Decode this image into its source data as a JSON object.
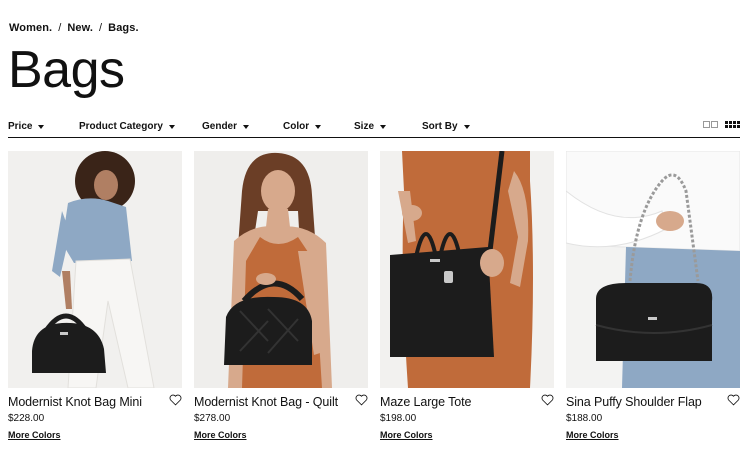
{
  "breadcrumb": [
    "Women.",
    "New.",
    "Bags."
  ],
  "breadcrumb_separator": "/",
  "page_title": "Bags",
  "filters": [
    "Price",
    "Product Category",
    "Gender",
    "Color",
    "Size",
    "Sort By"
  ],
  "view_options": [
    "two-column-grid-icon",
    "four-column-grid-icon"
  ],
  "products": [
    {
      "name": "Modernist Knot Bag Mini",
      "price": "$228.00",
      "colors_link": "More Colors",
      "background": "#f1f0ee"
    },
    {
      "name": "Modernist Knot Bag - Quilt",
      "price": "$278.00",
      "colors_link": "More Colors",
      "background": "#efeeec"
    },
    {
      "name": "Maze Large Tote",
      "price": "$198.00",
      "colors_link": "More Colors",
      "background": "#f2f1ef"
    },
    {
      "name": "Sina Puffy Shoulder Flap",
      "price": "$188.00",
      "colors_link": "More Colors",
      "background": "#f3f3f2"
    }
  ],
  "colors": {
    "text": "#111111",
    "skin": "#c99a7c",
    "dress": "#c06b3a",
    "bag": "#1c1c1c",
    "denim": "#8ea8c4",
    "hair_dark": "#3a2418",
    "hair_brown": "#6b3e26"
  }
}
